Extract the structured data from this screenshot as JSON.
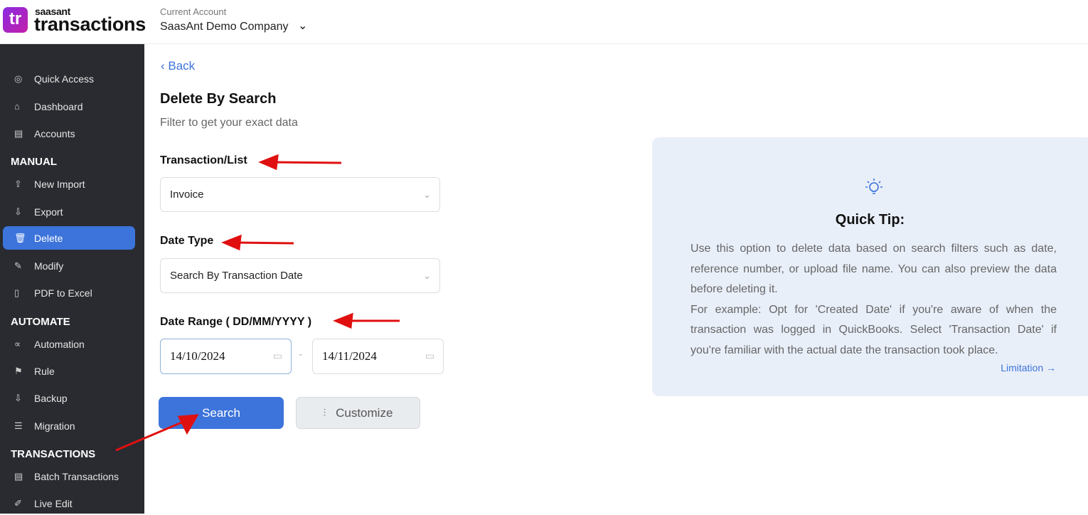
{
  "header": {
    "logo_mark": "tr",
    "logo_brand": "saasant",
    "logo_product": "transactions",
    "account_label": "Current Account",
    "account_name": "SaasAnt Demo Company"
  },
  "sidebar": {
    "top": [
      {
        "label": "Quick Access",
        "icon": "target-icon"
      },
      {
        "label": "Dashboard",
        "icon": "home-icon"
      },
      {
        "label": "Accounts",
        "icon": "clipboard-icon"
      }
    ],
    "sections": [
      {
        "title": "MANUAL",
        "items": [
          {
            "label": "New Import",
            "icon": "cloud-upload-icon"
          },
          {
            "label": "Export",
            "icon": "cloud-download-icon"
          },
          {
            "label": "Delete",
            "icon": "trash-icon",
            "active": true
          },
          {
            "label": "Modify",
            "icon": "file-edit-icon"
          },
          {
            "label": "PDF to Excel",
            "icon": "pdf-icon"
          }
        ]
      },
      {
        "title": "AUTOMATE",
        "items": [
          {
            "label": "Automation",
            "icon": "share-nodes-icon"
          },
          {
            "label": "Rule",
            "icon": "megaphone-icon"
          },
          {
            "label": "Backup",
            "icon": "cloud-download-icon"
          },
          {
            "label": "Migration",
            "icon": "indent-icon"
          }
        ]
      },
      {
        "title": "TRANSACTIONS",
        "items": [
          {
            "label": "Batch Transactions",
            "icon": "document-icon"
          },
          {
            "label": "Live Edit",
            "icon": "pencil-icon"
          }
        ]
      }
    ]
  },
  "main": {
    "back": "Back",
    "title": "Delete By Search",
    "subtitle": "Filter to get your exact data",
    "transaction_label": "Transaction/List",
    "transaction_value": "Invoice",
    "date_type_label": "Date Type",
    "date_type_value": "Search By Transaction Date",
    "date_range_label": "Date Range ( DD/MM/YYYY )",
    "date_from": "14/10/2024",
    "date_to": "14/11/2024",
    "date_sep": "-",
    "search": "Search",
    "customize": "Customize"
  },
  "tip": {
    "title": "Quick Tip:",
    "text1": "Use this option to delete data based on search filters such as date, reference number, or upload file name. You can also preview the data before deleting it.",
    "text2": "For example: Opt for 'Created Date' if you're aware of when the transaction was logged in QuickBooks. Select 'Transaction Date' if you're familiar with the actual date the transaction took place.",
    "limitation": "Limitation →"
  },
  "colors": {
    "accent": "#3d74db",
    "sidebar": "#292b30",
    "tip_bg": "#e9eff9",
    "annotation": "#e01010"
  }
}
